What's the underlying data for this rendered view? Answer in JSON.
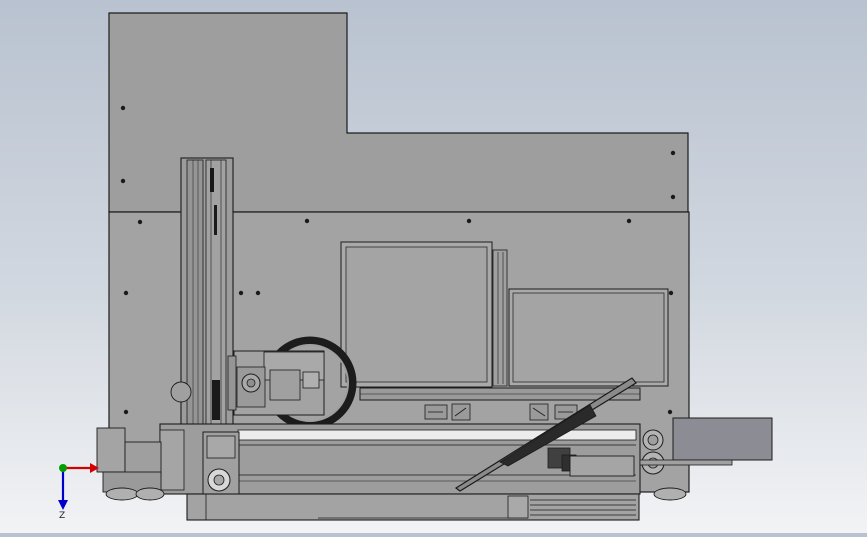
{
  "colors": {
    "background_top": "#b9c2d0",
    "background_bottom": "#f2f3f5",
    "body_fill": "#9d9d9d",
    "body_stroke": "#1c1c1c",
    "panel_fill": "#a7a7a7",
    "axis_x": "#d40000",
    "axis_y": "#00a000",
    "axis_z": "#0000cc"
  },
  "icons": {
    "orientation_triad": "xyz-triad-icon"
  },
  "triad": {
    "z_label": "Z"
  }
}
